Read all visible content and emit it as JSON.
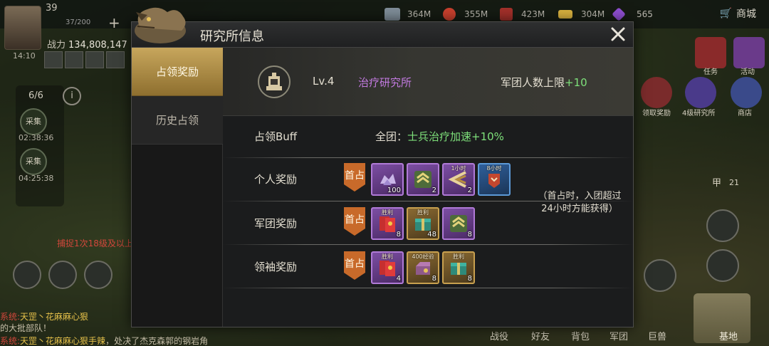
{
  "hud": {
    "level": "39",
    "hp_text": "37/200",
    "power_label": "战力",
    "power_value": "134,808,147",
    "resources": [
      {
        "icon": "steel-icon",
        "value": "364M"
      },
      {
        "icon": "food-icon",
        "value": "355M"
      },
      {
        "icon": "oil-icon",
        "value": "423M"
      },
      {
        "icon": "gold-bar-icon",
        "value": "304M"
      },
      {
        "icon": "gem-icon",
        "value": "565"
      }
    ],
    "shop_label": "商城",
    "queue_count": "6/6",
    "gather_label": "采集",
    "gather_timers": [
      "02:38:36",
      "04:25:38"
    ],
    "side_timer": "14:10",
    "capture_tip": "捕捉1次18级及以上",
    "chat": [
      {
        "prefix": "系统:",
        "name": "天罡丶花麻麻心狠",
        "text": ""
      },
      {
        "prefix": "",
        "name": "",
        "text": "的大批部队！"
      },
      {
        "prefix": "系统:",
        "name": "天罡丶花麻麻心狠手辣",
        "text": "，处决了杰克森郭的钢岩角"
      }
    ],
    "right_labels": [
      "任务",
      "活动",
      "领取奖励",
      "4级研究所",
      "商店"
    ],
    "bottom_nav": [
      "战役",
      "好友",
      "背包",
      "军团",
      "巨兽"
    ],
    "base_label": "基地",
    "badge_21": "21",
    "badge_jia": "甲"
  },
  "dialog": {
    "title": "研究所信息",
    "tabs": [
      {
        "label": "占领奖励",
        "active": true
      },
      {
        "label": "历史占领",
        "active": false
      }
    ],
    "building": {
      "level": "Lv.4",
      "name": "治疗研究所",
      "limit_label": "军团人数上限",
      "limit_bonus": "+10"
    },
    "buff": {
      "label": "占领Buff",
      "scope": "全团：",
      "effect": "士兵治疗加速+10%"
    },
    "first_badge": "首占",
    "rewards": [
      {
        "label": "个人奖励",
        "items": [
          {
            "icon": "crystal-ore-icon",
            "rarity": "purple",
            "count": "100",
            "tag": ""
          },
          {
            "icon": "rank-chevron-icon",
            "rarity": "purple",
            "count": "2",
            "tag": ""
          },
          {
            "icon": "speedup-arrow-icon",
            "rarity": "purple",
            "count": "2",
            "tag": "1小时"
          },
          {
            "icon": "speedup-badge-icon",
            "rarity": "blue",
            "count": "",
            "tag": "8小时"
          }
        ],
        "note": "（首占时，入团超过24小时方能获得）"
      },
      {
        "label": "军团奖励",
        "items": [
          {
            "icon": "red-envelope-icon",
            "rarity": "purple",
            "count": "8",
            "tag": "胜利"
          },
          {
            "icon": "supply-crate-icon",
            "rarity": "gold",
            "count": "48",
            "tag": "胜利"
          },
          {
            "icon": "rank-chevron-icon",
            "rarity": "purple",
            "count": "8",
            "tag": ""
          }
        ]
      },
      {
        "label": "领袖奖励",
        "items": [
          {
            "icon": "red-envelope-icon",
            "rarity": "purple",
            "count": "4",
            "tag": "胜利"
          },
          {
            "icon": "resource-crate-icon",
            "rarity": "gold",
            "count": "8",
            "tag": "400经验"
          },
          {
            "icon": "supply-crate-icon",
            "rarity": "gold",
            "count": "8",
            "tag": "胜利"
          }
        ]
      }
    ]
  }
}
